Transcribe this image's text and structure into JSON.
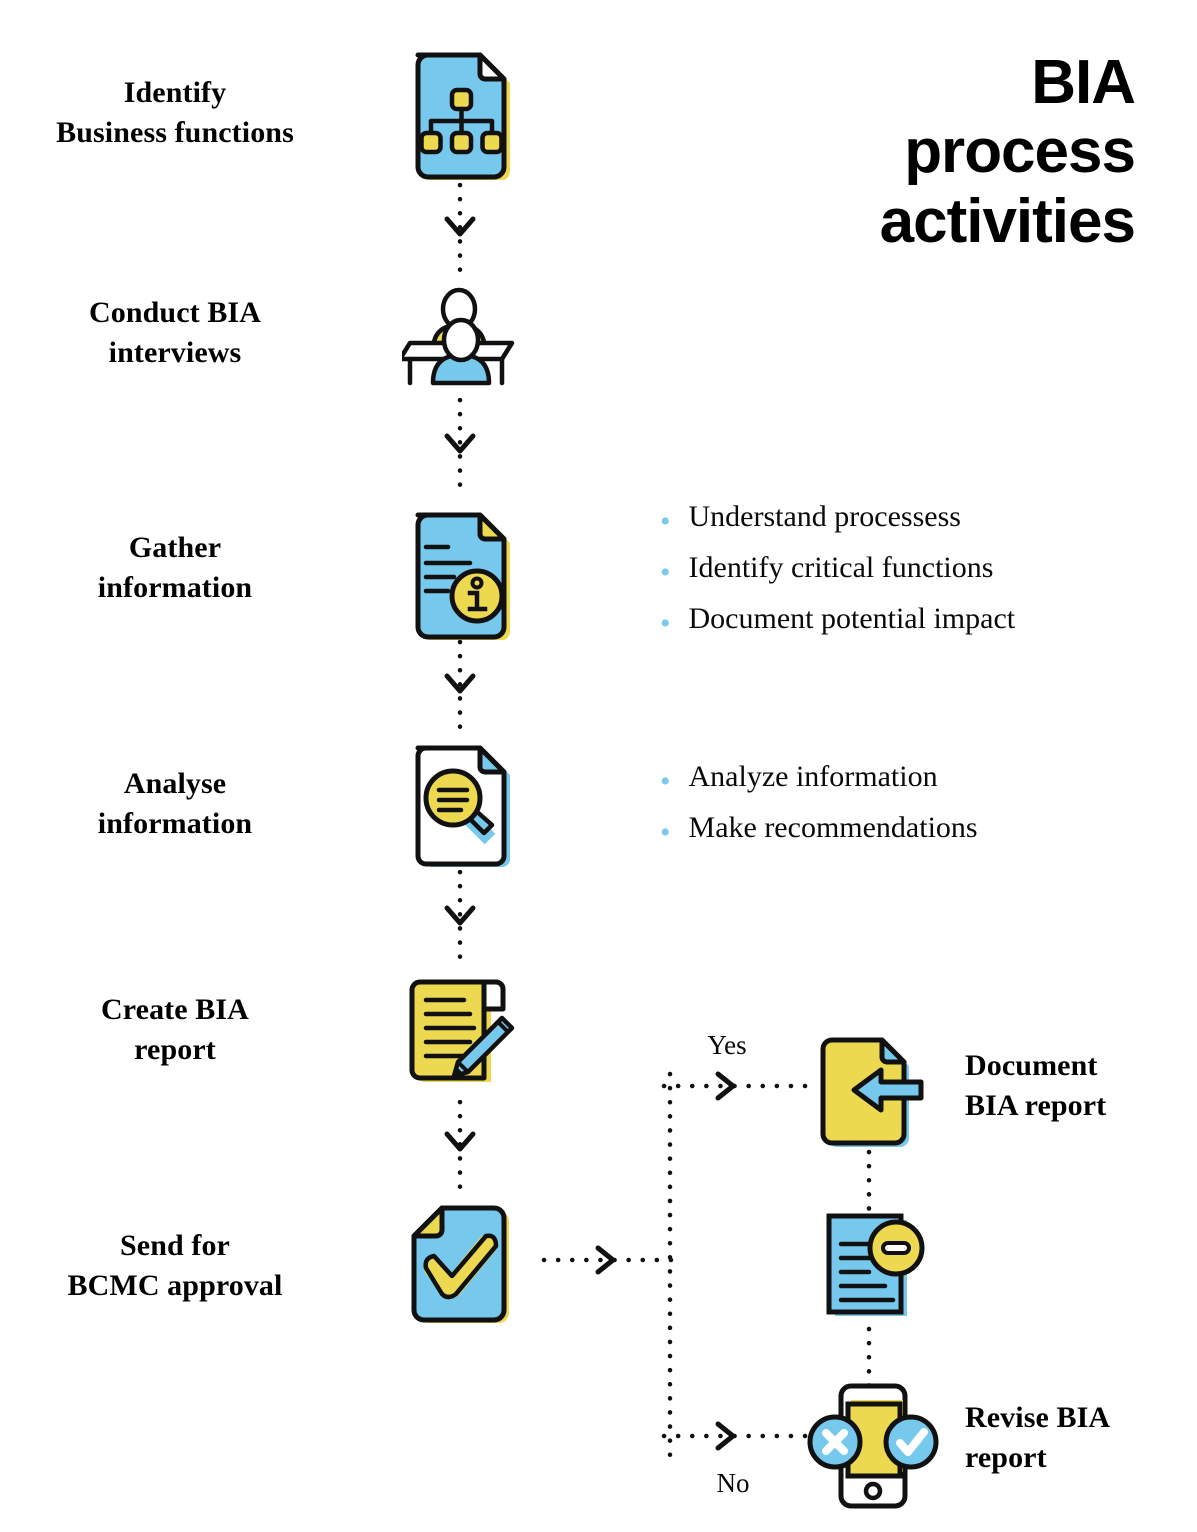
{
  "title": {
    "line1": "BIA",
    "line2": "process",
    "line3": "activities"
  },
  "colors": {
    "blue": "#76c8ec",
    "yellow": "#ecd94f",
    "outline": "#111111",
    "bullet": "#7cc9ec",
    "text": "#0a0a0a",
    "background": "#ffffff"
  },
  "steps": [
    {
      "id": "identify-business-functions",
      "label_line1": "Identify",
      "label_line2": "Business functions",
      "icon": "document-orgchart-icon"
    },
    {
      "id": "conduct-bia-interviews",
      "label_line1": "Conduct BIA",
      "label_line2": "interviews",
      "icon": "interview-people-icon"
    },
    {
      "id": "gather-information",
      "label_line1": "Gather",
      "label_line2": "information",
      "icon": "document-info-icon"
    },
    {
      "id": "analyse-information",
      "label_line1": "Analyse",
      "label_line2": "information",
      "icon": "document-magnifier-icon"
    },
    {
      "id": "create-bia-report",
      "label_line1": "Create BIA",
      "label_line2": "report",
      "icon": "document-pen-icon"
    },
    {
      "id": "send-for-bcmc-approval",
      "label_line1": "Send for",
      "label_line2": "BCMC approval",
      "icon": "document-check-icon"
    }
  ],
  "bullet_groups": [
    {
      "id": "gather-information-bullets",
      "items": [
        "Understand processess",
        "Identify critical functions",
        "Document potential impact"
      ]
    },
    {
      "id": "analyse-information-bullets",
      "items": [
        "Analyze information",
        "Make recommendations"
      ]
    }
  ],
  "decision": {
    "yes_label": "Yes",
    "no_label": "No"
  },
  "outcomes": [
    {
      "id": "document-bia-report",
      "label_line1": "Document",
      "label_line2": "BIA report",
      "icon": "document-arrow-in-icon"
    },
    {
      "id": "review-document",
      "label_line1": "",
      "label_line2": "",
      "icon": "document-minus-icon"
    },
    {
      "id": "revise-bia-report",
      "label_line1": "Revise BIA",
      "label_line2": "report",
      "icon": "phone-approve-reject-icon"
    }
  ]
}
